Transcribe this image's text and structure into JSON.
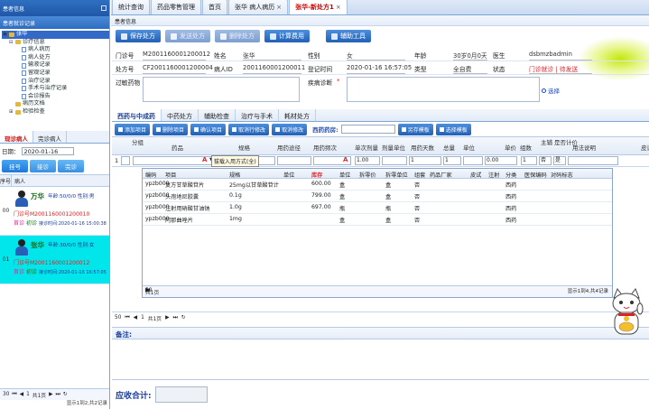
{
  "left_panel": {
    "title": "患者信息",
    "subtitle": "患者就诊记录",
    "tree": [
      {
        "label": "张华",
        "level": 0,
        "toggle": "▣",
        "kind": "folder",
        "selected": true
      },
      {
        "label": "诊疗信息",
        "level": 1,
        "toggle": "⊟",
        "kind": "folder",
        "selected": false
      },
      {
        "label": "病人病历",
        "level": 2,
        "toggle": "",
        "kind": "doc",
        "selected": false
      },
      {
        "label": "病人处方",
        "level": 2,
        "toggle": "",
        "kind": "doc",
        "selected": false
      },
      {
        "label": "输液记录",
        "level": 2,
        "toggle": "",
        "kind": "doc",
        "selected": false
      },
      {
        "label": "留观记录",
        "level": 2,
        "toggle": "",
        "kind": "doc",
        "selected": false
      },
      {
        "label": "治疗记录",
        "level": 2,
        "toggle": "",
        "kind": "doc",
        "selected": false
      },
      {
        "label": "手术与治疗记录",
        "level": 2,
        "toggle": "",
        "kind": "doc",
        "selected": false
      },
      {
        "label": "会诊报告",
        "level": 2,
        "toggle": "",
        "kind": "doc",
        "selected": false
      },
      {
        "label": "病历文档",
        "level": 1,
        "toggle": "",
        "kind": "folder",
        "selected": false
      },
      {
        "label": "检验检查",
        "level": 1,
        "toggle": "⊞",
        "kind": "folder",
        "selected": false
      }
    ],
    "tabs": [
      "现诊病人",
      "完诊病人"
    ],
    "date_label": "日期：",
    "date_value": "2020-01-16",
    "buttons": [
      "挂号",
      "接诊",
      "完诊"
    ],
    "col_idx": "序号",
    "col_patient": "病人",
    "patients": [
      {
        "idx": "00",
        "name": "万华",
        "info": "年龄:50/0/0  性别:男",
        "mz": "门诊号M2001160001200010",
        "visit": "首诊",
        "note": "初诊",
        "time": "接诊时间:2020-01-16 15:00:38",
        "highlight": false
      },
      {
        "idx": "01",
        "name": "张华",
        "info": "年龄:30/0/0  性别:女",
        "mz": "门诊号M2001160001200012",
        "visit": "首诊",
        "note": "初诊",
        "time": "接诊时间:2020-01-16 16:57:05",
        "highlight": true
      }
    ],
    "pager": {
      "size": "30",
      "page": "1",
      "of": "共1页"
    },
    "total": "显示1到2,共2记录"
  },
  "tabs": [
    {
      "label": "统计查询",
      "active": false,
      "closable": false
    },
    {
      "label": "药品零售管理",
      "active": false,
      "closable": false
    },
    {
      "label": "首页",
      "active": false,
      "closable": false
    },
    {
      "label": "张华 病人病历",
      "active": false,
      "closable": true
    },
    {
      "label": "张华-新处方1",
      "active": true,
      "closable": true
    }
  ],
  "breadcrumb": "患者信息",
  "toolbar": [
    {
      "label": "保存处方",
      "disabled": false
    },
    {
      "label": "发送处方",
      "disabled": true
    },
    {
      "label": "删除处方",
      "disabled": true
    },
    {
      "label": "计算费用",
      "disabled": false
    },
    {
      "label": "辅助工具",
      "disabled": false
    }
  ],
  "form": {
    "mz_label": "门诊号",
    "mz_value": "M2001160001200012",
    "name_label": "姓名",
    "name_value": "张华",
    "sex_label": "性别",
    "sex_value": "女",
    "age_label": "年龄",
    "age_value": "30岁0月0天",
    "doctor_label": "医生",
    "doctor_value": "dsbmzbadmin",
    "rx_label": "处方号",
    "rx_value": "CF2001160001200004",
    "pid_label": "病人ID",
    "pid_value": "2001160001200011",
    "time_label": "登记时间",
    "time_value": "2020-01-16 16:57:05",
    "type_label": "类型",
    "type_value": "全自费",
    "status_label": "状态",
    "status_value": "门诊就诊 | 待发送",
    "allergy_label": "过敏药物",
    "diag_label": "疾病诊断",
    "diag_required": "*",
    "choose": "选择"
  },
  "glow_color": "#c6e600",
  "rx_tabs": [
    "西药与中成药",
    "中药处方",
    "辅助检查",
    "治疗与手术",
    "耗材处方"
  ],
  "rx_buttons": [
    "添加项目",
    "删除项目",
    "确认项目",
    "取消行修改",
    "取消修改",
    "另存模板",
    "选择模板"
  ],
  "rx_source_label": "西药药房:",
  "grid": {
    "headers": [
      "分组",
      "药品",
      "规格",
      "用药途径",
      "用药频次",
      "单次剂量",
      "剂量单位",
      "用药天数",
      "总量",
      "单位",
      "单价",
      "组数",
      "主辅",
      "是否计价",
      "用法说明",
      "皮试"
    ],
    "input_row": {
      "num": "1",
      "dose": "1.00",
      "days": "1",
      "total": "1",
      "price": "0.00",
      "group": "1",
      "main": "否",
      "billing": "是"
    },
    "tooltip": "拔载入用方式(全)"
  },
  "dropdown": {
    "headers": [
      "编码",
      "项目",
      "规格",
      "单位",
      "库存",
      "单位",
      "拆零价",
      "拆零单位",
      "组套",
      "药品厂家",
      "皮试",
      "注射",
      "分类",
      "医保编码",
      "对码标志"
    ],
    "rows": [
      [
        "ypzb000",
        "复方甘草酸苷片",
        "25mg以甘草酸苷计",
        "",
        "600.00",
        "盒",
        "",
        "盒",
        "否",
        "",
        "",
        "",
        "西药",
        "",
        ""
      ],
      [
        "ypzb000",
        "头孢地尼胶囊",
        "0.1g",
        "",
        "799.00",
        "盒",
        "",
        "盒",
        "否",
        "",
        "",
        "",
        "西药",
        "",
        ""
      ],
      [
        "ypzb000",
        "注射用硝酸甘油钠",
        "1.0g",
        "",
        "697.00",
        "瓶",
        "",
        "瓶",
        "否",
        "",
        "",
        "",
        "西药",
        "",
        ""
      ],
      [
        "ypzb000",
        "阿那曲唑片",
        "1mg",
        "",
        "",
        "盒",
        "",
        "盒",
        "否",
        "",
        "",
        "",
        "西药",
        "",
        ""
      ]
    ],
    "pager": {
      "size": "50",
      "page": "1",
      "of": "共1页"
    },
    "total": "显示1到4,共4记录"
  },
  "rx_pager": {
    "size": "50",
    "page": "1",
    "of": "共1页"
  },
  "remark_label": "备注:",
  "fee_label": "应收合计:"
}
